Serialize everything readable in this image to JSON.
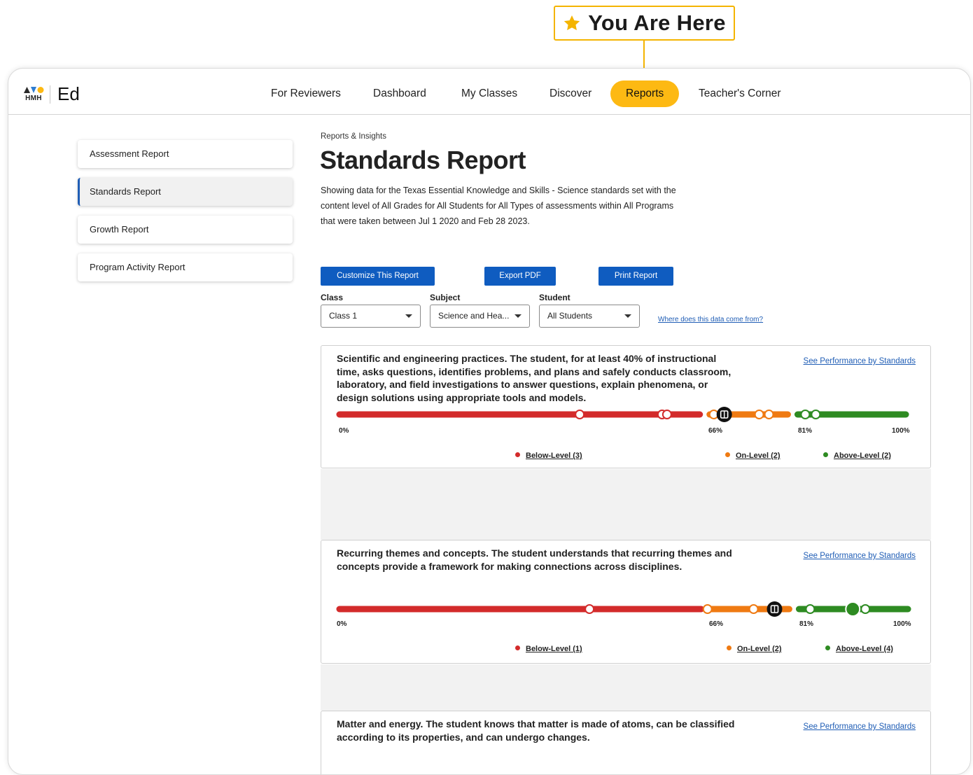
{
  "callout": {
    "text": "You Are Here",
    "icon": "star-icon",
    "color": "#f4b400"
  },
  "brand": {
    "mark": "HMH",
    "product": "Ed"
  },
  "nav": [
    "For Reviewers",
    "Dashboard",
    "My Classes",
    "Discover",
    "Reports",
    "Teacher's Corner"
  ],
  "nav_active": "Reports",
  "sidebar": {
    "items": [
      "Assessment Report",
      "Standards Report",
      "Growth Report",
      "Program Activity Report"
    ],
    "active": "Standards Report"
  },
  "page": {
    "breadcrumb": "Reports & Insights",
    "title": "Standards Report",
    "description": "Showing data for the Texas Essential Knowledge and Skills - Science standards set with the content level of All Grades for All Students for All Types of assessments within All Programs that were taken between Jul 1 2020 and Feb 28 2023."
  },
  "actions": {
    "customize": "Customize This Report",
    "export": "Export PDF",
    "print": "Print Report"
  },
  "filters": {
    "class_label": "Class",
    "class_value": "Class 1",
    "subject_label": "Subject",
    "subject_value": "Science and Hea...",
    "student_label": "Student",
    "student_value": "All Students",
    "help_link": "Where does this data come from?"
  },
  "colors": {
    "below": "#d32b2b",
    "on": "#ef7a12",
    "above": "#2e8b22",
    "primary": "#0f5cc0",
    "accent": "#fdb913"
  },
  "scale": {
    "min_label": "0%",
    "on_label": "66%",
    "above_label": "81%",
    "max_label": "100%"
  },
  "standards": [
    {
      "title": "Scientific and engineering practices. The student, for at least 40% of instructional time, asks questions, identifies problems, and plans and safely conducts classroom, laboratory, and field investigations to answer questions, explain phenomena, or design solutions using appropriate tools and models.",
      "link": "See Performance by Standards",
      "legend": {
        "below": "Below-Level (3)",
        "on": "On-Level (2)",
        "above": "Above-Level (2)"
      }
    },
    {
      "title": "Recurring themes and concepts. The student understands that recurring themes and concepts provide a framework for making connections across disciplines.",
      "link": "See Performance by Standards",
      "legend": {
        "below": "Below-Level (1)",
        "on": "On-Level (2)",
        "above": "Above-Level (4)"
      }
    },
    {
      "title": "Matter and energy. The student knows that matter is made of atoms, can be classified according to its properties, and can undergo changes.",
      "link": "See Performance by Standards"
    }
  ]
}
